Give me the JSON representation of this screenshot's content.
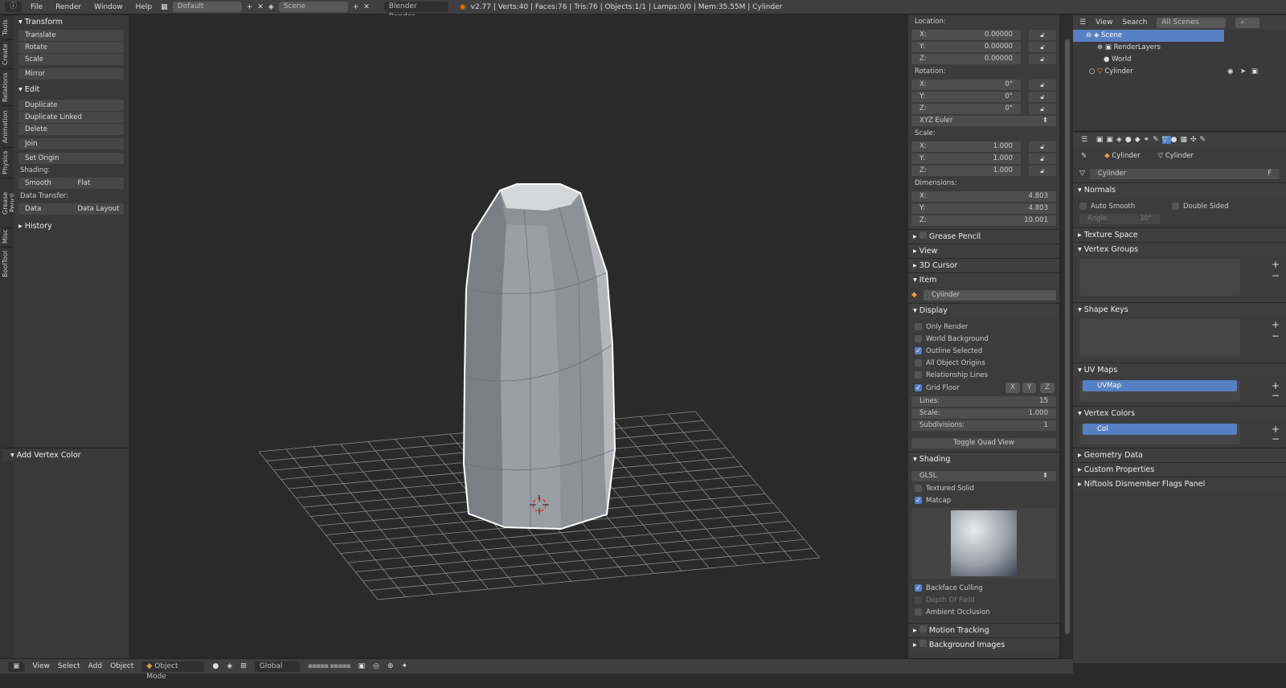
{
  "topbar": {
    "menus": [
      "File",
      "Render",
      "Window",
      "Help"
    ],
    "layout": "Default",
    "scene": "Scene",
    "engine": "Blender Render",
    "stats": "v2.77 | Verts:40 | Faces:76 | Tris:76 | Objects:1/1 | Lamps:0/0 | Mem:35.55M | Cylinder"
  },
  "left_tabs": [
    "Tools",
    "Create",
    "Relations",
    "Animation",
    "Physics",
    "Grease Pencil",
    "Misc",
    "BoolTool"
  ],
  "tools": {
    "transform": "Transform",
    "translate": "Translate",
    "rotate": "Rotate",
    "scale": "Scale",
    "mirror": "Mirror",
    "edit": "Edit",
    "duplicate": "Duplicate",
    "duplicate_linked": "Duplicate Linked",
    "delete": "Delete",
    "join": "Join",
    "set_origin": "Set Origin",
    "shading": "Shading:",
    "smooth": "Smooth",
    "flat": "Flat",
    "data_transfer": "Data Transfer:",
    "data": "Data",
    "data_layout": "Data Layout",
    "history": "History",
    "add_vertex_color": "Add Vertex Color"
  },
  "npanel": {
    "location_label": "Location:",
    "location": [
      {
        "axis": "X:",
        "value": "0.00000"
      },
      {
        "axis": "Y:",
        "value": "0.00000"
      },
      {
        "axis": "Z:",
        "value": "0.00000"
      }
    ],
    "rotation_label": "Rotation:",
    "rotation": [
      {
        "axis": "X:",
        "value": "0°"
      },
      {
        "axis": "Y:",
        "value": "0°"
      },
      {
        "axis": "Z:",
        "value": "0°"
      }
    ],
    "rotation_mode": "XYZ Euler",
    "scale_label": "Scale:",
    "scale": [
      {
        "axis": "X:",
        "value": "1.000"
      },
      {
        "axis": "Y:",
        "value": "1.000"
      },
      {
        "axis": "Z:",
        "value": "1.000"
      }
    ],
    "dimensions_label": "Dimensions:",
    "dimensions": [
      {
        "axis": "X:",
        "value": "4.803"
      },
      {
        "axis": "Y:",
        "value": "4.803"
      },
      {
        "axis": "Z:",
        "value": "10.001"
      }
    ],
    "grease_pencil": "Grease Pencil",
    "view": "View",
    "cursor": "3D Cursor",
    "item": "Item",
    "item_name": "Cylinder",
    "display": "Display",
    "only_render": "Only Render",
    "world_background": "World Background",
    "outline_selected": "Outline Selected",
    "all_object_origins": "All Object Origins",
    "relationship_lines": "Relationship Lines",
    "grid_floor": "Grid Floor",
    "x": "X",
    "y": "Y",
    "z": "Z",
    "lines_label": "Lines:",
    "lines": "15",
    "scale2_label": "Scale:",
    "scale2": "1.000",
    "subdiv_label": "Subdivisions:",
    "subdiv": "1",
    "toggle_quad": "Toggle Quad View",
    "shading": "Shading",
    "shading_mode": "GLSL",
    "textured_solid": "Textured Solid",
    "matcap": "Matcap",
    "backface_culling": "Backface Culling",
    "depth_of_field": "Depth Of Field",
    "ambient_occlusion": "Ambient Occlusion",
    "motion_tracking": "Motion Tracking",
    "background_images": "Background Images"
  },
  "outliner": {
    "view": "View",
    "search": "Search",
    "filter": "All Scenes",
    "items": [
      "Scene",
      "RenderLayers",
      "World",
      "Cylinder"
    ]
  },
  "properties": {
    "breadcrumb_object": "Cylinder",
    "breadcrumb_mesh": "Cylinder",
    "mesh_name": "Cylinder",
    "fake_user": "F",
    "normals": "Normals",
    "auto_smooth": "Auto Smooth",
    "double_sided": "Double Sided",
    "angle": "Angle:",
    "angle_value": "30°",
    "texture_space": "Texture Space",
    "vertex_groups": "Vertex Groups",
    "shape_keys": "Shape Keys",
    "uv_maps": "UV Maps",
    "uvmap": "UVMap",
    "vertex_colors": "Vertex Colors",
    "col": "Col",
    "geometry_data": "Geometry Data",
    "custom_properties": "Custom Properties",
    "niftools": "Niftools Dismember Flags Panel"
  },
  "bottombar": {
    "view": "View",
    "select": "Select",
    "add": "Add",
    "object": "Object",
    "mode": "Object Mode",
    "orientation": "Global"
  },
  "colors": {
    "accent": "#5680c2",
    "grid": "#8a8a8a",
    "mesh": "#9a9da2",
    "outline": "#ffffff"
  }
}
